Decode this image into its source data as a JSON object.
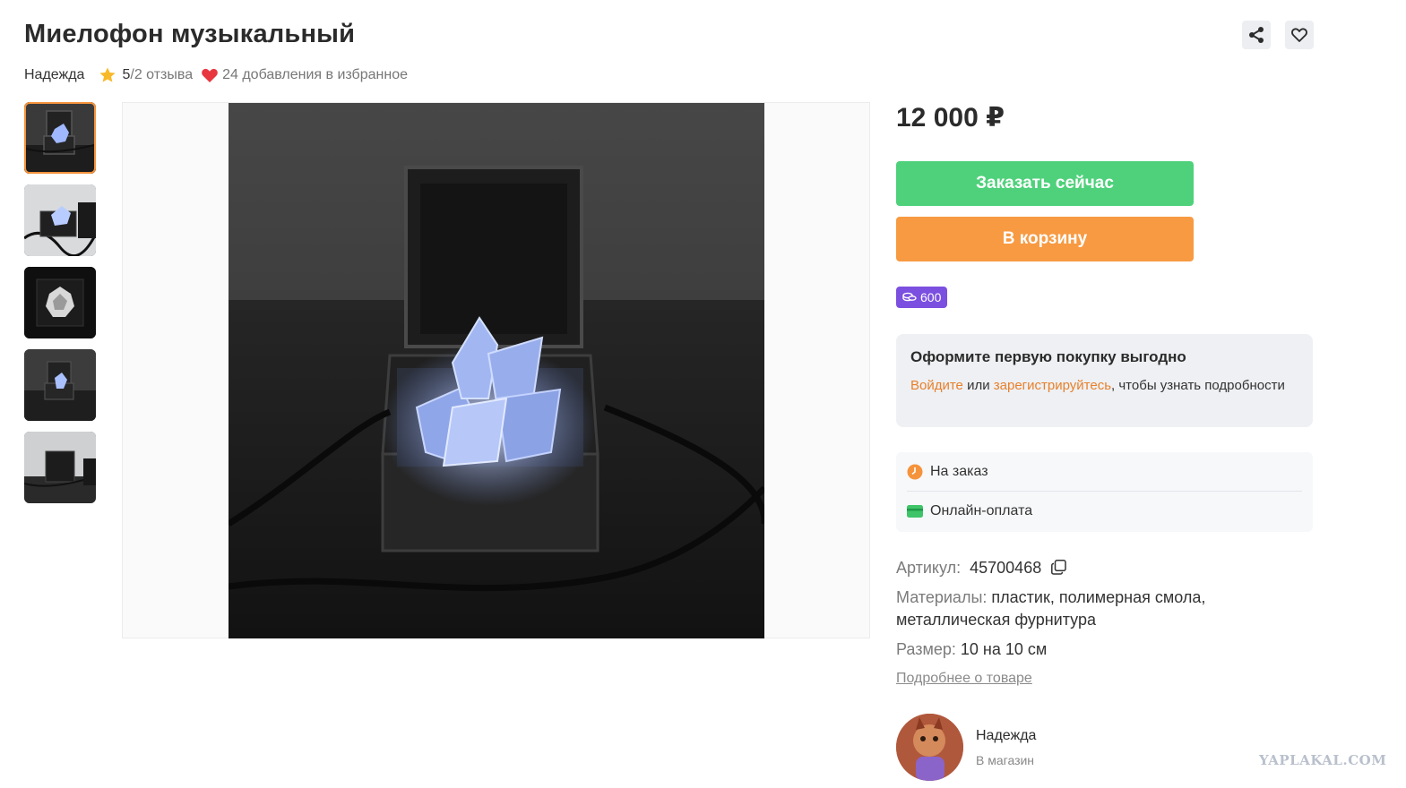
{
  "product": {
    "title": "Миелофон музыкальный",
    "seller": "Надежда",
    "rating": "5",
    "slash": " / ",
    "reviews": "2 отзыва",
    "favorites": "24 добавления в избранное",
    "price": "12 000 ₽"
  },
  "header_actions": {
    "share_icon": "share-icon",
    "favorite_icon": "heart-outline-icon"
  },
  "gallery": {
    "thumbnails_count": 5,
    "active_index": 0
  },
  "buttons": {
    "order_label": "Заказать сейчас",
    "cart_label": "В корзину"
  },
  "bonus": {
    "icon": "coins-icon",
    "value": "600"
  },
  "promo": {
    "title": "Оформите первую покупку выгодно",
    "login_link": "Войдите",
    "or_text": " или ",
    "register_link": "зарегистрируйтесь",
    "rest_text": ", чтобы узнать подробности"
  },
  "delivery": {
    "availability": "На заказ",
    "payment": "Онлайн-оплата"
  },
  "attributes": {
    "article_label": "Артикул:",
    "article_value": "45700468",
    "materials_label": "Материалы:",
    "materials_value": "пластик, полимерная смола, металлическая фурнитура",
    "size_label": "Размер:",
    "size_value": "10 на 10 см",
    "more_link": "Подробнее о товаре"
  },
  "shop": {
    "name": "Надежда",
    "link": "В магазин"
  },
  "watermark": "YAPLAKAL.COM",
  "colors": {
    "order_button": "#4fd17b",
    "cart_button": "#f79a42",
    "bonus_badge": "#7b4fe0",
    "link_accent": "#e8802b",
    "heart": "#e8363f",
    "star": "#f7b928"
  }
}
